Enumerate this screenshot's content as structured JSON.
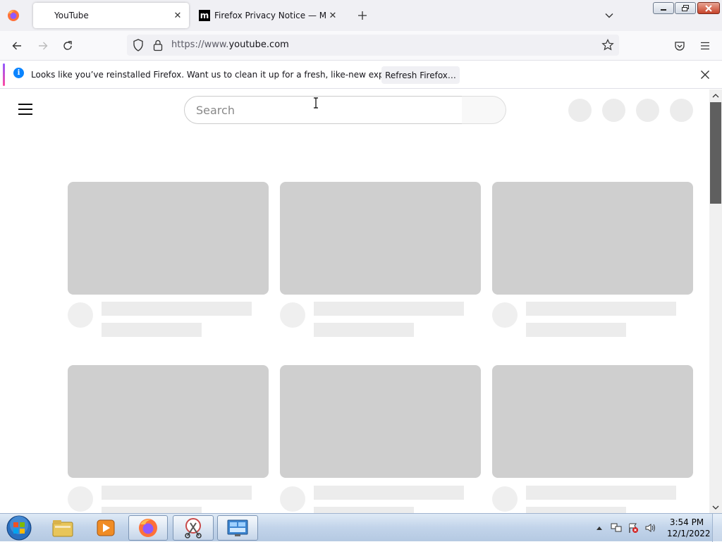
{
  "browser": {
    "tabs": [
      {
        "title": "YouTube",
        "active": true
      },
      {
        "title": "Firefox Privacy Notice — Mozilla",
        "active": false,
        "favicon_letter": "m"
      }
    ],
    "url": {
      "prefix": "https://www.",
      "host": "youtube.com"
    },
    "notification": {
      "message": "Looks like you’ve reinstalled Firefox. Want us to clean it up for a fresh, like-new experience?",
      "button_label": "Refresh Firefox…",
      "info_glyph": "i"
    },
    "icons": {
      "tab_close": "close-icon",
      "new_tab": "plus-icon",
      "list_all_tabs": "chevron-down-icon",
      "back": "back-arrow-icon",
      "forward": "forward-arrow-icon",
      "reload": "reload-icon",
      "tracking_protection": "shield-icon",
      "connection": "lock-icon",
      "bookmark": "star-icon",
      "pocket": "pocket-icon",
      "app_menu": "hamburger-menu-icon"
    }
  },
  "page": {
    "search": {
      "placeholder": "Search"
    },
    "skeleton_rows": 2,
    "skeleton_columns": 3,
    "header_placeholders": 4
  },
  "taskbar": {
    "clock": {
      "time": "3:54 PM",
      "date": "12/1/2022"
    },
    "items": [
      "windows-explorer-icon",
      "media-player-icon",
      "firefox-icon",
      "snipping-tool-icon",
      "control-panel-icon"
    ]
  },
  "colors": {
    "skeleton_thumb": "#cfcfcf",
    "skeleton_text": "#ececec",
    "info_blue": "#0a84ff",
    "accent_gradient_start": "#9059ff",
    "accent_gradient_end": "#ff4aa2"
  }
}
